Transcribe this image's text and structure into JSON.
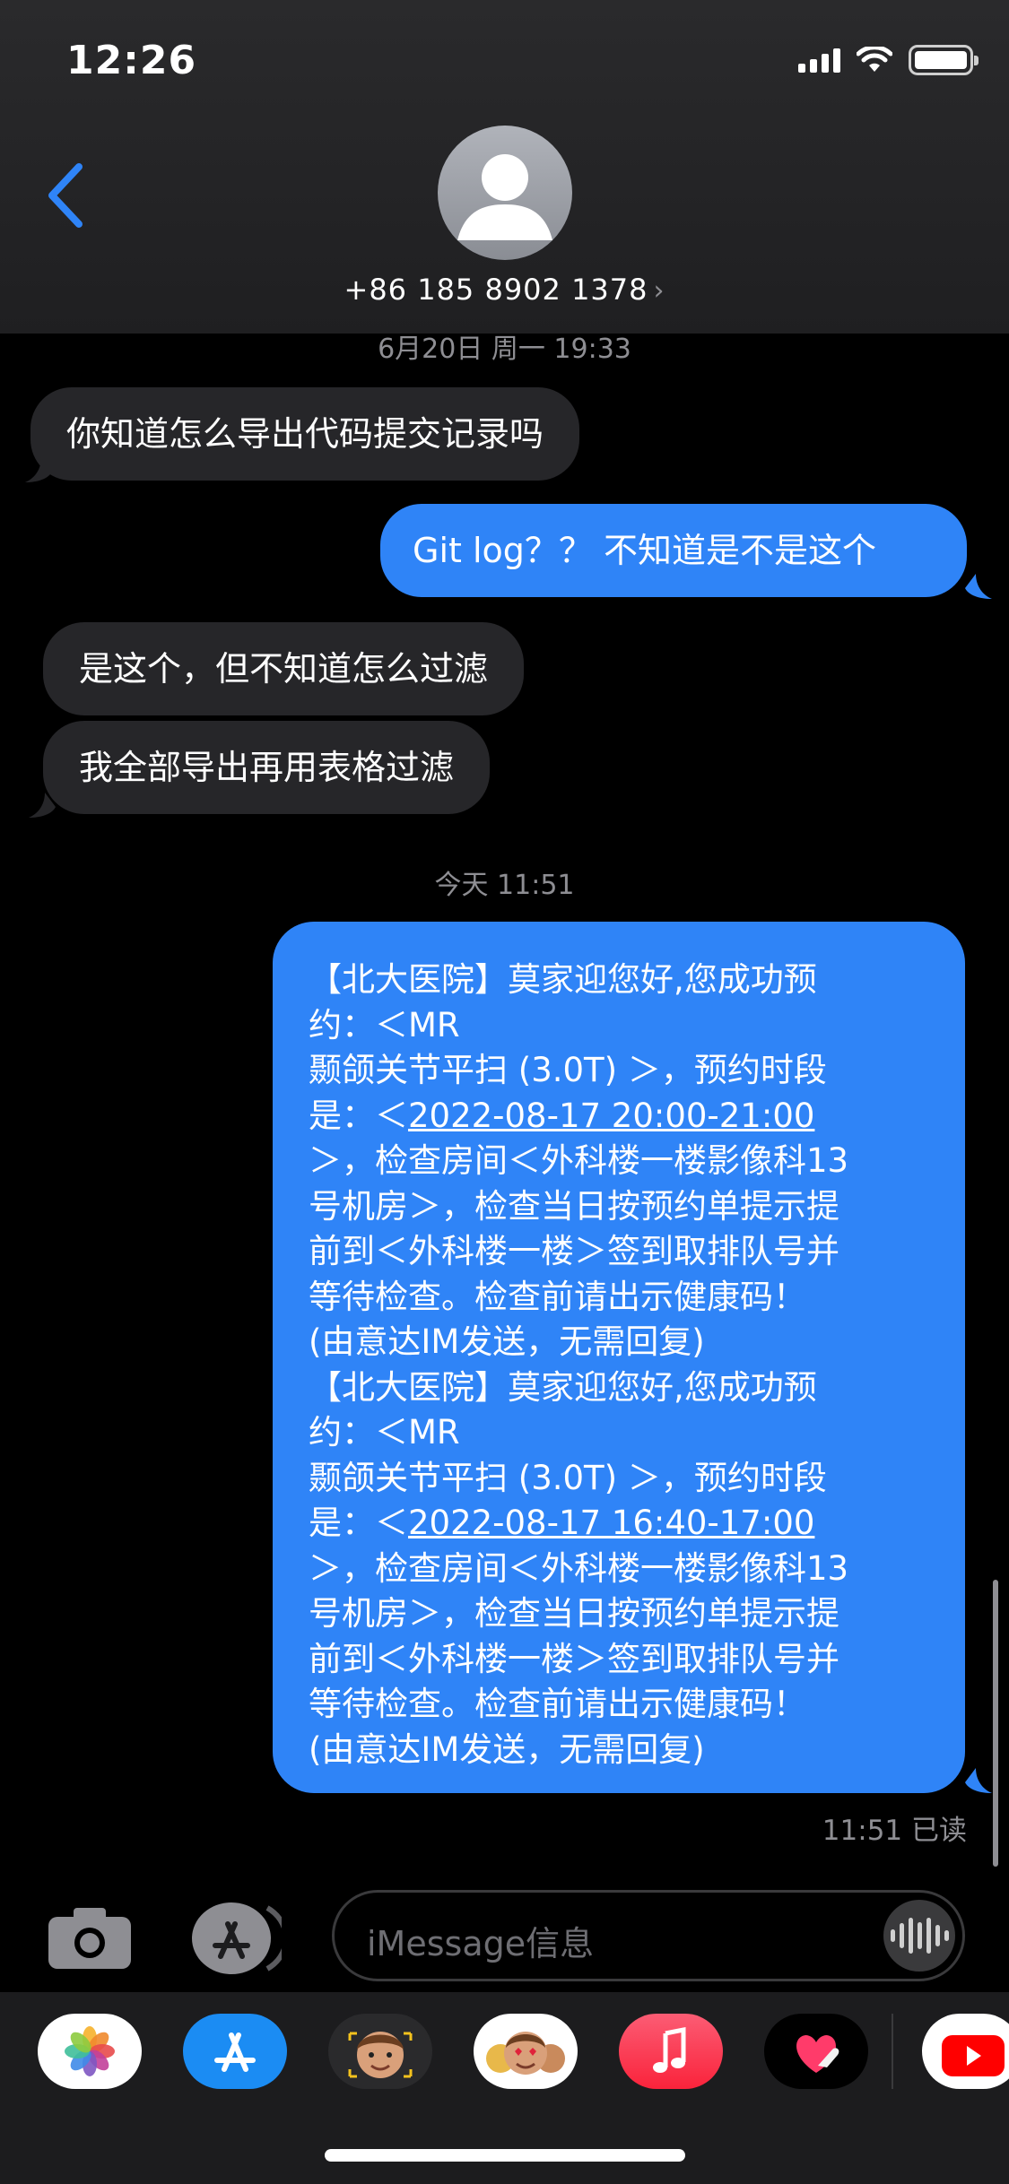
{
  "status_bar": {
    "time": "12:26"
  },
  "header": {
    "contact": "+86 185 8902 1378",
    "chevron": "›"
  },
  "thread": {
    "timestamp_1": "6月20日 周一 19:33",
    "messages_1": [
      {
        "dir": "in",
        "text": "你知道怎么导出代码提交记录吗"
      },
      {
        "dir": "out",
        "text": "Git log？？ 不知道是不是这个"
      },
      {
        "dir": "in",
        "text": "是这个，但不知道怎么过滤"
      },
      {
        "dir": "in",
        "text": "我全部导出再用表格过滤"
      }
    ],
    "timestamp_2": "今天 11:51",
    "long_message": {
      "part1": {
        "l1": "【北大医院】莫家迎您好,您成功预",
        "l2": "约：＜MR",
        "l3": " 颞颌关节平扫 (3.0T) ＞，预约时段",
        "l4_pre": "是：＜",
        "l4_link": "2022-08-17 20:00-21:00",
        "l5": "＞，检查房间＜外科楼一楼影像科13",
        "l6": "号机房＞，检查当日按预约单提示提",
        "l7": "前到＜外科楼一楼＞签到取排队号并",
        "l8": "等待检查。检查前请出示健康码！",
        "l9": "(由意达IM发送，无需回复)"
      },
      "part2": {
        "l1": "【北大医院】莫家迎您好,您成功预",
        "l2": "约：＜MR",
        "l3": " 颞颌关节平扫 (3.0T) ＞，预约时段",
        "l4_pre": "是：＜",
        "l4_link": "2022-08-17 16:40-17:00",
        "l5": "＞，检查房间＜外科楼一楼影像科13",
        "l6": "号机房＞，检查当日按预约单提示提",
        "l7": "前到＜外科楼一楼＞签到取排队号并",
        "l8": "等待检查。检查前请出示健康码！",
        "l9": "(由意达IM发送，无需回复)"
      }
    },
    "receipt": "11:51 已读"
  },
  "composer": {
    "placeholder": "iMessage信息"
  },
  "app_drawer": {
    "apps": [
      "photos-icon",
      "app-store-icon",
      "memoji-icon",
      "animoji-icon",
      "music-icon",
      "digital-touch-icon",
      "youtube-icon"
    ]
  },
  "colors": {
    "outgoing": "#2f84f7",
    "incoming": "#262629",
    "accent": "#2f84f7"
  }
}
